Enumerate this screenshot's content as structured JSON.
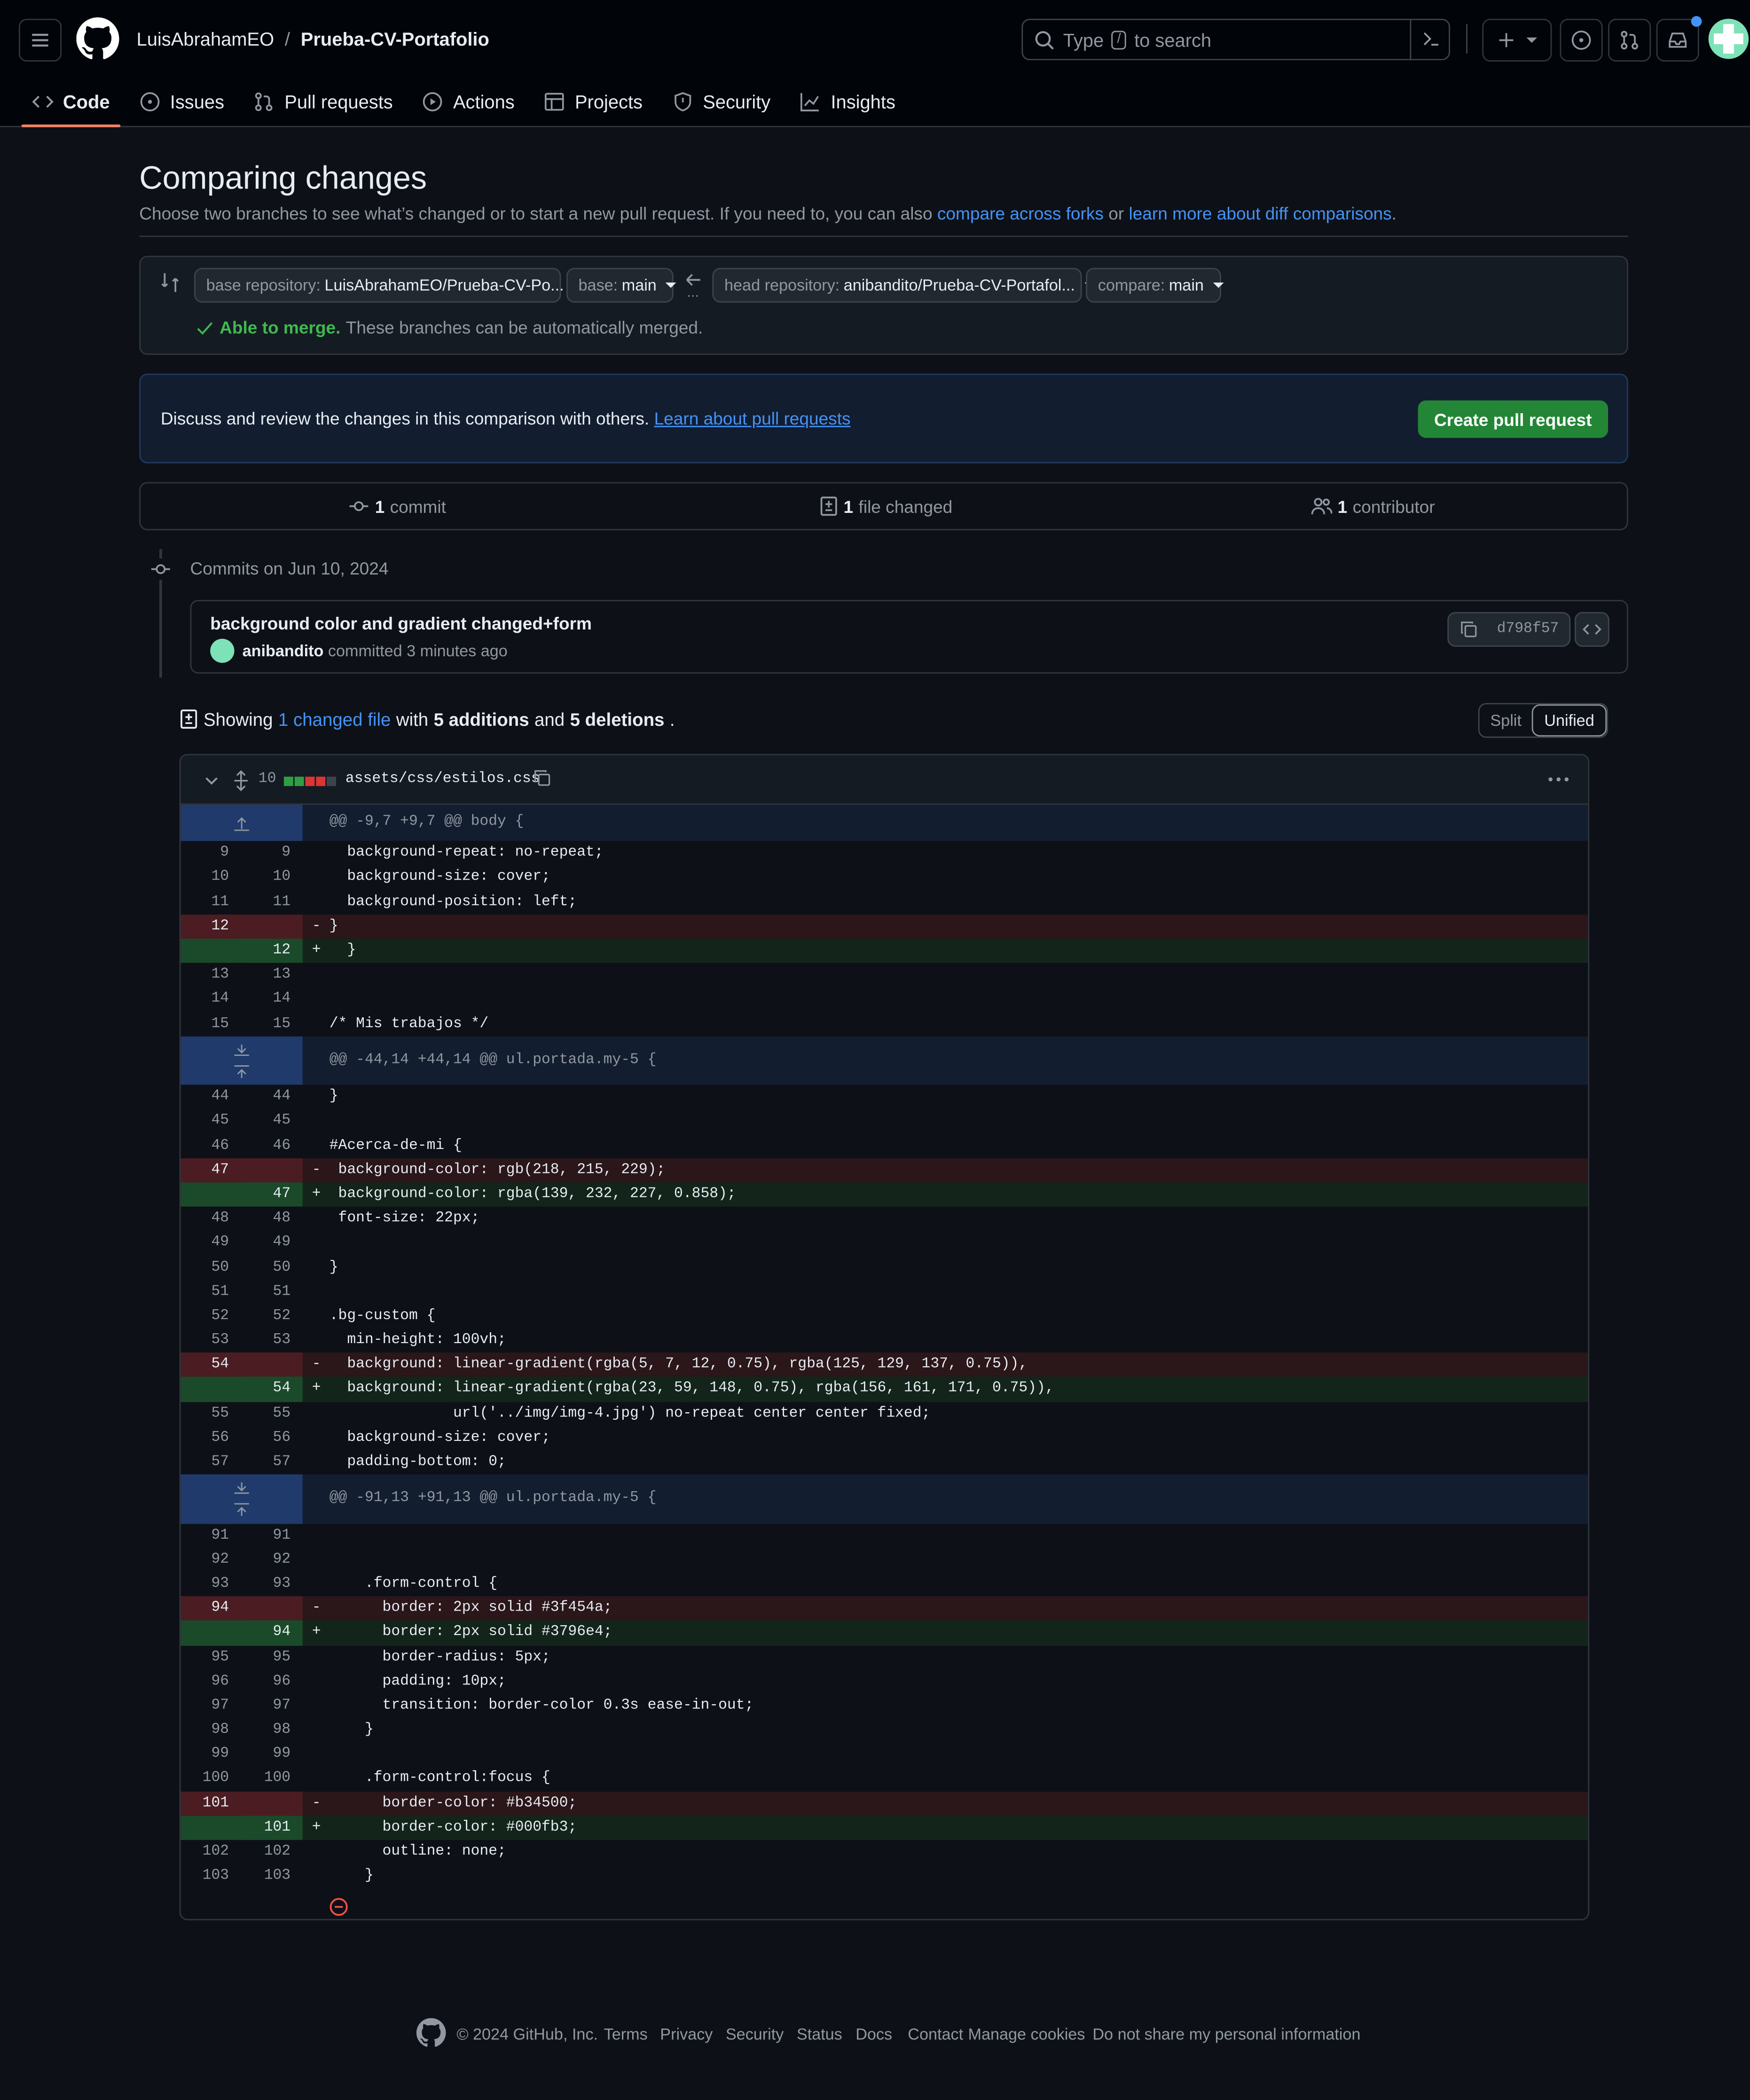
{
  "header": {
    "owner": "LuisAbrahamEO",
    "separator": "/",
    "repo": "Prueba-CV-Portafolio",
    "search_placeholder_pre": "Type",
    "search_key": "/",
    "search_placeholder_post": "to search"
  },
  "tabs": [
    {
      "label": "Code",
      "icon": "code-icon",
      "active": true
    },
    {
      "label": "Issues",
      "icon": "issue-icon"
    },
    {
      "label": "Pull requests",
      "icon": "pull-request-icon"
    },
    {
      "label": "Actions",
      "icon": "play-icon"
    },
    {
      "label": "Projects",
      "icon": "table-icon"
    },
    {
      "label": "Security",
      "icon": "shield-icon"
    },
    {
      "label": "Insights",
      "icon": "graph-icon"
    }
  ],
  "page": {
    "title": "Comparing changes",
    "subtitle": "Choose two branches to see what’s changed or to start a new pull request. If you need to, you can also",
    "link_forks": "compare across forks",
    "or": "or",
    "link_learn": "learn more about diff comparisons",
    "period": "."
  },
  "compare": {
    "base_repo_label": "base repository:",
    "base_repo": "LuisAbrahamEO/Prueba-CV-Po...",
    "base_label": "base:",
    "base": "main",
    "head_repo_label": "head repository:",
    "head_repo": "anibandito/Prueba-CV-Portafol...",
    "compare_label": "compare:",
    "compare": "main",
    "merge_status": "Able to merge.",
    "merge_note": "These branches can be automatically merged."
  },
  "discuss": {
    "text": "Discuss and review the changes in this comparison with others.",
    "link": "Learn about pull requests",
    "button": "Create pull request"
  },
  "stats": {
    "commits": "1",
    "commits_label": "commit",
    "files": "1",
    "files_label": "file changed",
    "contributors": "1",
    "contributors_label": "contributor"
  },
  "commits": {
    "date_heading": "Commits on Jun 10, 2024",
    "message": "background color and gradient changed+form",
    "author": "anibandito",
    "time": "committed 3 minutes ago",
    "sha": "d798f57"
  },
  "summary": {
    "showing": "Showing",
    "changed": "1 changed file",
    "with": "with",
    "additions": "5 additions",
    "and": "and",
    "deletions": "5 deletions",
    "period": "."
  },
  "view_toggle": {
    "split": "Split",
    "unified": "Unified"
  },
  "file": {
    "changes": "10",
    "path": "assets/css/estilos.css"
  },
  "diff_rows": [
    {
      "t": "hunk",
      "code": "@@ -9,7 +9,7 @@ body {"
    },
    {
      "t": "ctx",
      "a": "9",
      "b": "9",
      "code": "  background-repeat: no-repeat;"
    },
    {
      "t": "ctx",
      "a": "10",
      "b": "10",
      "code": "  background-size: cover;"
    },
    {
      "t": "ctx",
      "a": "11",
      "b": "11",
      "code": "  background-position: left;"
    },
    {
      "t": "del",
      "a": "12",
      "b": "",
      "code": "}"
    },
    {
      "t": "add",
      "a": "",
      "b": "12",
      "code": "  }"
    },
    {
      "t": "ctx",
      "a": "13",
      "b": "13",
      "code": ""
    },
    {
      "t": "ctx",
      "a": "14",
      "b": "14",
      "code": ""
    },
    {
      "t": "ctx",
      "a": "15",
      "b": "15",
      "code": "/* Mis trabajos */"
    },
    {
      "t": "hunk2",
      "code": "@@ -44,14 +44,14 @@ ul.portada.my-5 {"
    },
    {
      "t": "ctx",
      "a": "44",
      "b": "44",
      "code": "}"
    },
    {
      "t": "ctx",
      "a": "45",
      "b": "45",
      "code": ""
    },
    {
      "t": "ctx",
      "a": "46",
      "b": "46",
      "code": "#Acerca-de-mi {"
    },
    {
      "t": "del",
      "a": "47",
      "b": "",
      "code": " background-color: rgb(218, 215, 229);"
    },
    {
      "t": "add",
      "a": "",
      "b": "47",
      "code": " background-color: rgba(139, 232, 227, 0.858);"
    },
    {
      "t": "ctx",
      "a": "48",
      "b": "48",
      "code": " font-size: 22px;"
    },
    {
      "t": "ctx",
      "a": "49",
      "b": "49",
      "code": ""
    },
    {
      "t": "ctx",
      "a": "50",
      "b": "50",
      "code": "}"
    },
    {
      "t": "ctx",
      "a": "51",
      "b": "51",
      "code": ""
    },
    {
      "t": "ctx",
      "a": "52",
      "b": "52",
      "code": ".bg-custom {"
    },
    {
      "t": "ctx",
      "a": "53",
      "b": "53",
      "code": "  min-height: 100vh;"
    },
    {
      "t": "del",
      "a": "54",
      "b": "",
      "code": "  background: linear-gradient(rgba(5, 7, 12, 0.75), rgba(125, 129, 137, 0.75)),"
    },
    {
      "t": "add",
      "a": "",
      "b": "54",
      "code": "  background: linear-gradient(rgba(23, 59, 148, 0.75), rgba(156, 161, 171, 0.75)),"
    },
    {
      "t": "ctx",
      "a": "55",
      "b": "55",
      "code": "              url('../img/img-4.jpg') no-repeat center center fixed;"
    },
    {
      "t": "ctx",
      "a": "56",
      "b": "56",
      "code": "  background-size: cover;"
    },
    {
      "t": "ctx",
      "a": "57",
      "b": "57",
      "code": "  padding-bottom: 0;"
    },
    {
      "t": "hunk2",
      "code": "@@ -91,13 +91,13 @@ ul.portada.my-5 {"
    },
    {
      "t": "ctx",
      "a": "91",
      "b": "91",
      "code": ""
    },
    {
      "t": "ctx",
      "a": "92",
      "b": "92",
      "code": ""
    },
    {
      "t": "ctx",
      "a": "93",
      "b": "93",
      "code": "    .form-control {"
    },
    {
      "t": "del",
      "a": "94",
      "b": "",
      "code": "      border: 2px solid #3f454a;"
    },
    {
      "t": "add",
      "a": "",
      "b": "94",
      "code": "      border: 2px solid #3796e4;"
    },
    {
      "t": "ctx",
      "a": "95",
      "b": "95",
      "code": "      border-radius: 5px;"
    },
    {
      "t": "ctx",
      "a": "96",
      "b": "96",
      "code": "      padding: 10px;"
    },
    {
      "t": "ctx",
      "a": "97",
      "b": "97",
      "code": "      transition: border-color 0.3s ease-in-out;"
    },
    {
      "t": "ctx",
      "a": "98",
      "b": "98",
      "code": "    }"
    },
    {
      "t": "ctx",
      "a": "99",
      "b": "99",
      "code": ""
    },
    {
      "t": "ctx",
      "a": "100",
      "b": "100",
      "code": "    .form-control:focus {"
    },
    {
      "t": "del",
      "a": "101",
      "b": "",
      "code": "      border-color: #b34500;"
    },
    {
      "t": "add",
      "a": "",
      "b": "101",
      "code": "      border-color: #000fb3;"
    },
    {
      "t": "ctx",
      "a": "102",
      "b": "102",
      "code": "      outline: none;"
    },
    {
      "t": "ctx",
      "a": "103",
      "b": "103",
      "code": "    }"
    }
  ],
  "footer": {
    "copyright": "© 2024 GitHub, Inc.",
    "links": [
      "Terms",
      "Privacy",
      "Security",
      "Status",
      "Docs",
      "Contact",
      "Manage cookies",
      "Do not share my personal information"
    ]
  },
  "colors": {
    "accent": "#4493f8",
    "green": "#238636",
    "del": "#4b1d22",
    "add": "#1b4a2a"
  }
}
